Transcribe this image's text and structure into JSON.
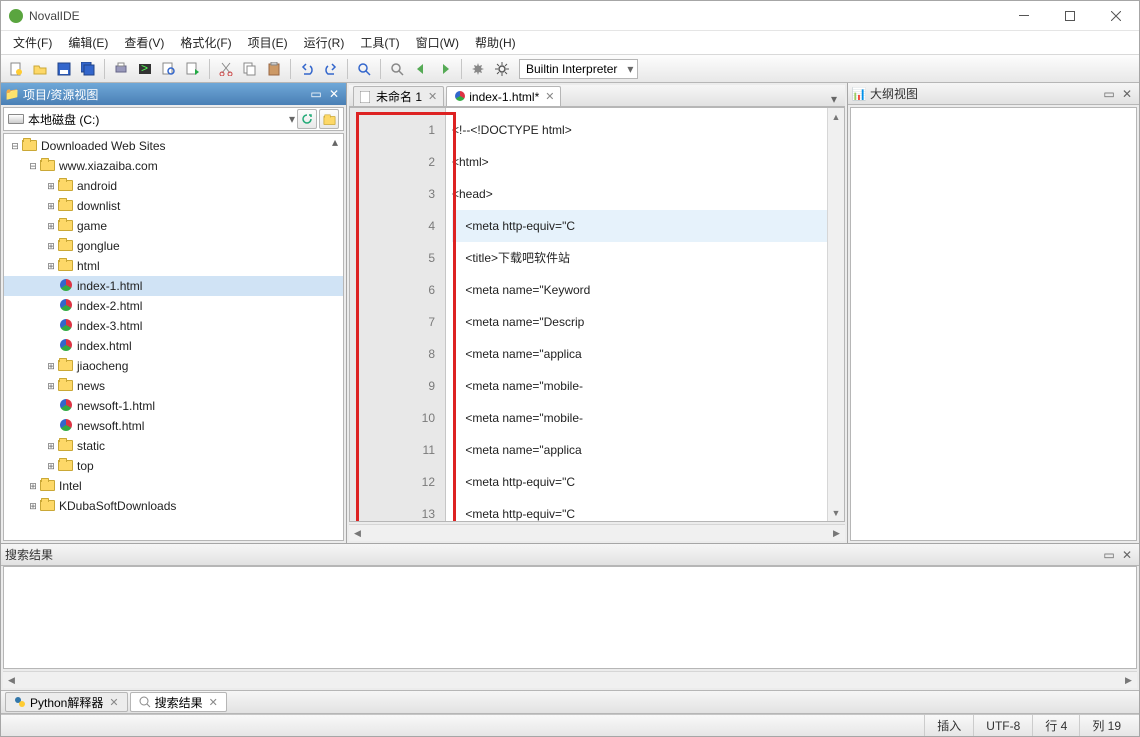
{
  "app": {
    "title": "NovalIDE"
  },
  "menu": [
    "文件(F)",
    "编辑(E)",
    "查看(V)",
    "格式化(F)",
    "项目(E)",
    "运行(R)",
    "工具(T)",
    "窗口(W)",
    "帮助(H)"
  ],
  "toolbar": {
    "icons": [
      "new-file",
      "open-file",
      "save",
      "save-all",
      "print",
      "terminal",
      "find-in-files",
      "run-script",
      "cut",
      "copy",
      "paste",
      "undo",
      "redo",
      "zoom-out",
      "find",
      "back",
      "forward",
      "debug",
      "settings"
    ],
    "interpreter": "Builtin Interpreter"
  },
  "projectPanel": {
    "title": "项目/资源视图",
    "drive": "本地磁盘 (C:)",
    "tree": [
      {
        "d": 0,
        "t": "folder",
        "l": "Downloaded Web Sites",
        "e": "-"
      },
      {
        "d": 1,
        "t": "folder",
        "l": "www.xiazaiba.com",
        "e": "-"
      },
      {
        "d": 2,
        "t": "folder",
        "l": "android",
        "e": "+"
      },
      {
        "d": 2,
        "t": "folder",
        "l": "downlist",
        "e": "+"
      },
      {
        "d": 2,
        "t": "folder",
        "l": "game",
        "e": "+"
      },
      {
        "d": 2,
        "t": "folder",
        "l": "gonglue",
        "e": "+"
      },
      {
        "d": 2,
        "t": "folder",
        "l": "html",
        "e": "+"
      },
      {
        "d": 2,
        "t": "html",
        "l": "index-1.html",
        "e": "",
        "sel": true
      },
      {
        "d": 2,
        "t": "html",
        "l": "index-2.html",
        "e": ""
      },
      {
        "d": 2,
        "t": "html",
        "l": "index-3.html",
        "e": ""
      },
      {
        "d": 2,
        "t": "html",
        "l": "index.html",
        "e": ""
      },
      {
        "d": 2,
        "t": "folder",
        "l": "jiaocheng",
        "e": "+"
      },
      {
        "d": 2,
        "t": "folder",
        "l": "news",
        "e": "+"
      },
      {
        "d": 2,
        "t": "html",
        "l": "newsoft-1.html",
        "e": ""
      },
      {
        "d": 2,
        "t": "html",
        "l": "newsoft.html",
        "e": ""
      },
      {
        "d": 2,
        "t": "folder",
        "l": "static",
        "e": "+"
      },
      {
        "d": 2,
        "t": "folder",
        "l": "top",
        "e": "+"
      },
      {
        "d": 1,
        "t": "folder",
        "l": "Intel",
        "e": "+"
      },
      {
        "d": 1,
        "t": "folder",
        "l": "KDubaSoftDownloads",
        "e": "+"
      }
    ]
  },
  "editor": {
    "tabs": [
      {
        "label": "未命名 1",
        "active": false
      },
      {
        "label": "index-1.html*",
        "active": true
      }
    ],
    "lines": [
      "<!--<!DOCTYPE html>",
      "<html>",
      "<head>",
      "    <meta http-equiv=\"C",
      "    <title>下载吧软件站",
      "    <meta name=\"Keyword",
      "    <meta name=\"Descrip",
      "    <meta name=\"applica",
      "    <meta name=\"mobile-",
      "    <meta name=\"mobile-",
      "    <meta name=\"applica",
      "    <meta http-equiv=\"C",
      "    <meta http-equiv=\"C"
    ],
    "highlightLine": 4
  },
  "outline": {
    "title": "大纲视图"
  },
  "searchPanel": {
    "title": "搜索结果"
  },
  "bottomTabs": [
    {
      "label": "Python解释器",
      "active": false
    },
    {
      "label": "搜索结果",
      "active": true
    }
  ],
  "status": {
    "insert": "插入",
    "encoding": "UTF-8",
    "line": "行 4",
    "col": "列 19"
  }
}
